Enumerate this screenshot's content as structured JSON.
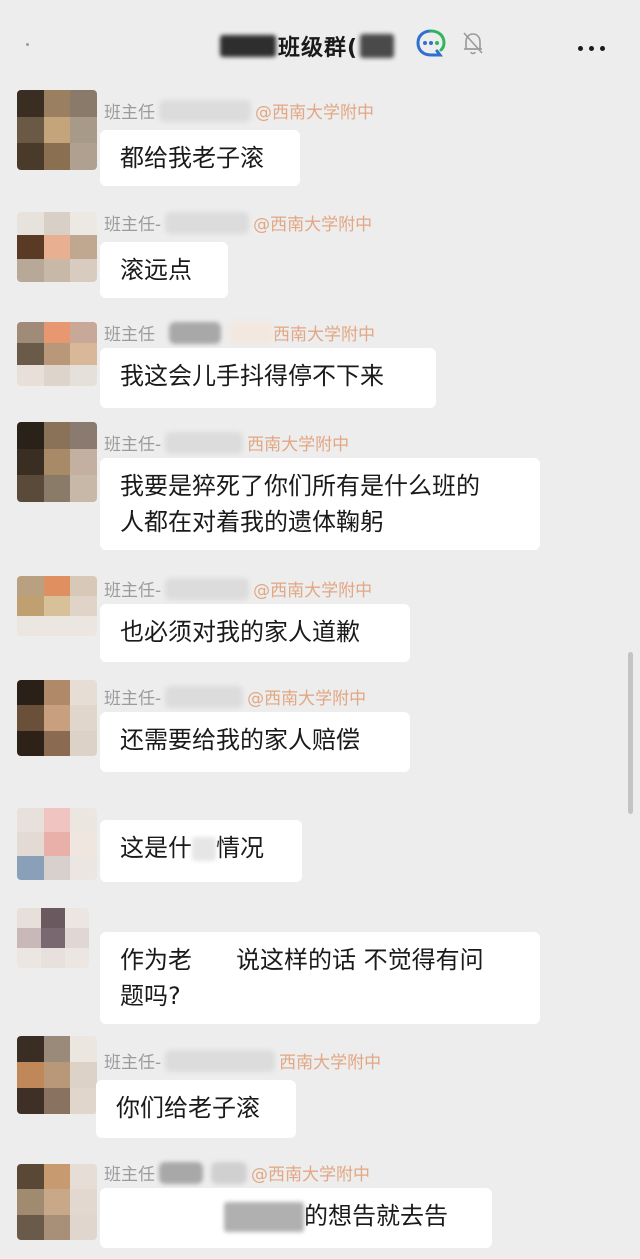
{
  "header": {
    "title": "班级群(",
    "icons": [
      "customer-service-icon",
      "mute-bell-icon",
      "more-icon"
    ]
  },
  "messages": [
    {
      "sender_prefix": "班主任",
      "school": "@西南大学附中",
      "text": "都给我老子滚"
    },
    {
      "sender_prefix": "班主任-",
      "school": "@西南大学附中",
      "text": "滚远点"
    },
    {
      "sender_prefix": "班主任",
      "school": "西南大学附中",
      "text": "我这会儿手抖得停不下来"
    },
    {
      "sender_prefix": "班主任-",
      "school": "西南大学附中",
      "line1": "我要是猝死了你们所有是什么班的",
      "line2": "人都在对着我的遗体鞠躬"
    },
    {
      "sender_prefix": "班主任-",
      "school": "@西南大学附中",
      "text": "也必须对我的家人道歉"
    },
    {
      "sender_prefix": "班主任-",
      "school": "@西南大学附中",
      "text": "还需要给我的家人赔偿"
    },
    {
      "text_a": "这是什",
      "text_b": "情况"
    },
    {
      "line1_a": "作为老",
      "line1_b": "说这样的话 不觉得有问",
      "line2": "题吗?"
    },
    {
      "sender_prefix": "班主任-",
      "school": "西南大学附中",
      "text": "你们给老子滚"
    },
    {
      "sender_prefix": "班主任",
      "school": "@西南大学附中",
      "text": "的想告就去告"
    }
  ],
  "colors": {
    "background": "#ededed",
    "bubble": "#ffffff",
    "sender": "#9b9b9b",
    "school": "#e2a784",
    "cs_icon_blue": "#2f6fd1",
    "cs_icon_green": "#2fb560"
  }
}
